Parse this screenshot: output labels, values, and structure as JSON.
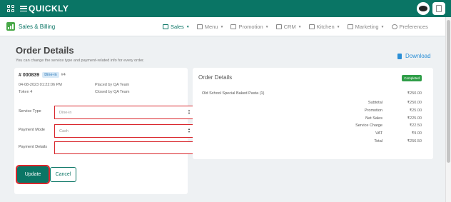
{
  "app": {
    "logo_text": "QUICKLY",
    "brand_label": "Sales & Billing"
  },
  "nav": {
    "items": [
      {
        "label": "Sales",
        "icon": "monitor-icon",
        "active": true
      },
      {
        "label": "Menu",
        "icon": "menu-icon",
        "active": false
      },
      {
        "label": "Promotion",
        "icon": "tag-icon",
        "active": false
      },
      {
        "label": "CRM",
        "icon": "users-icon",
        "active": false
      },
      {
        "label": "Kitchen",
        "icon": "chef-icon",
        "active": false
      },
      {
        "label": "Marketing",
        "icon": "megaphone-icon",
        "active": false
      },
      {
        "label": "Preferences",
        "icon": "gear-icon",
        "active": false
      }
    ]
  },
  "page": {
    "title": "Order Details",
    "subtitle": "You can change the service type and payment-related info for every order.",
    "download_label": "Download"
  },
  "order": {
    "number": "# 000839",
    "service_badge": "Dine-in",
    "table": "#4",
    "datetime": "04-08-2023 01:22:06 PM",
    "token": "Token 4",
    "placed_by": "Placed by QA Team",
    "closed_by": "Closed by QA Team"
  },
  "form": {
    "service_type_label": "Service Type",
    "service_type_value": "Dine-in",
    "payment_mode_label": "Payment Mode",
    "payment_mode_value": "Cash",
    "payment_details_label": "Payment Details",
    "payment_details_value": "",
    "update_label": "Update",
    "cancel_label": "Cancel"
  },
  "summary": {
    "title": "Order Details",
    "status": "Completed",
    "item_name": "Old School Special Baked Pasta (1)",
    "item_amount": "₹250.00",
    "rows": [
      {
        "label": "Subtotal",
        "value": "₹250.00"
      },
      {
        "label": "Promotion",
        "value": "₹25.00"
      },
      {
        "label": "Net Sales",
        "value": "₹225.00"
      },
      {
        "label": "Service Charge",
        "value": "₹22.50"
      },
      {
        "label": "VAT",
        "value": "₹9.00"
      },
      {
        "label": "Total",
        "value": "₹256.50"
      }
    ]
  },
  "colors": {
    "primary": "#0a7565",
    "highlight_border": "#d9262c",
    "completed_badge": "#2f9e48",
    "link": "#2b8fd6"
  }
}
